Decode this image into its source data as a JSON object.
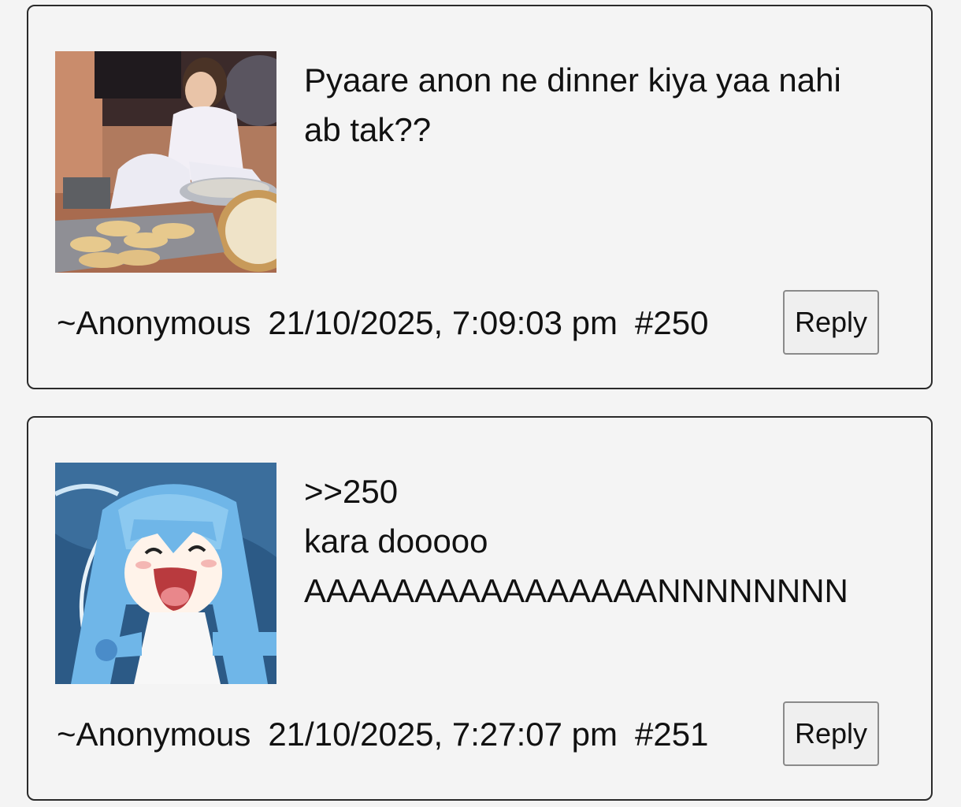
{
  "posts": [
    {
      "image_alt": "photo-thumbnail",
      "lines": [
        "Pyaare anon ne dinner kiya yaa nahi",
        "ab tak??"
      ],
      "author": "~Anonymous",
      "timestamp": "21/10/2025, 7:09:03 pm",
      "number": "#250",
      "reply_label": "Reply"
    },
    {
      "image_alt": "anime-thumbnail",
      "lines": [
        ">>250",
        "kara dooooo",
        "AAAAAAAAAAAAAAAANNNNNNNN"
      ],
      "author": "~Anonymous",
      "timestamp": "21/10/2025, 7:27:07 pm",
      "number": "#251",
      "reply_label": "Reply"
    }
  ]
}
